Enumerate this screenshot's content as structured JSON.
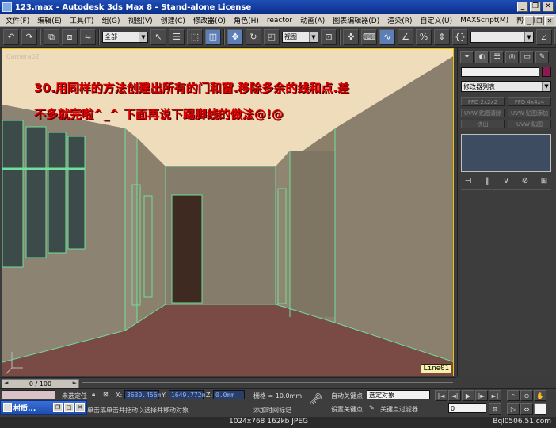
{
  "window": {
    "title": "123.max - Autodesk 3ds Max 8 - Stand-alone License",
    "minimize": "_",
    "restore": "❐",
    "close": "✕"
  },
  "menu": {
    "items": [
      "文件(F)",
      "编辑(E)",
      "工具(T)",
      "组(G)",
      "视图(V)",
      "创建(C)",
      "修改器(O)",
      "角色(H)",
      "reactor",
      "动画(A)",
      "图表编辑器(D)",
      "渲染(R)",
      "自定义(U)",
      "MAXScript(M)",
      "帮助(H)"
    ],
    "right_buttons": [
      "_",
      "❐",
      "✕"
    ]
  },
  "toolbar": {
    "selection_filter": "全部",
    "reference_coord": "视图",
    "named_selection": "",
    "icons": [
      "undo-icon",
      "redo-icon",
      "link-icon",
      "unlink-icon",
      "bind-space-warp-icon",
      "select-icon",
      "select-by-name-icon",
      "region-select-icon",
      "window-crossing-icon",
      "move-icon",
      "rotate-icon",
      "scale-icon",
      "pivot-icon",
      "snap-icon",
      "angle-snap-icon",
      "percent-snap-icon",
      "spinner-snap-icon",
      "mirror-icon",
      "align-icon"
    ]
  },
  "viewport": {
    "label": "Camera02",
    "tutorial_text": [
      "30.用同样的方法创建出所有的门和窗.移除多余的线和点.差",
      "不多就完啦^_^    下面再说下踢脚线的做法@!@"
    ],
    "selected_object": "Line01"
  },
  "timeline": {
    "frame": "0 / 100"
  },
  "status": {
    "selection": "未选定任",
    "x_label": "X:",
    "x_value": "3630.456m",
    "y_label": "Y:",
    "y_value": "1649.772m",
    "z_label": "Z:",
    "z_value": "0.0mm",
    "grid": "栅格 = 10.0mm",
    "add_time_tag": "添加时间标记",
    "prompt": "单击或单击并拖动以选择并移动对象",
    "auto_key": "自动关键点",
    "set_key": "设置关键点",
    "key_mode": "选定对象",
    "key_filters": "关键点过滤器...",
    "frame_field": "0"
  },
  "taskbar": {
    "label": "村质..."
  },
  "caption": {
    "info": "1024x768  162kb  JPEG",
    "watermark": "Bql0506.51.com"
  },
  "command_panel": {
    "tabs": [
      "create-tab-icon",
      "modify-tab-icon",
      "hierarchy-tab-icon",
      "motion-tab-icon",
      "display-tab-icon",
      "utilities-tab-icon"
    ],
    "modifier_list": "修改器列表",
    "buttons": [
      "FFD 2x2x2",
      "FFD 4x4x4",
      "UVW 贴图清除",
      "UVW 贴图添加",
      "挤出",
      "UVW 贴图"
    ],
    "object_color": "#8b1a52"
  }
}
